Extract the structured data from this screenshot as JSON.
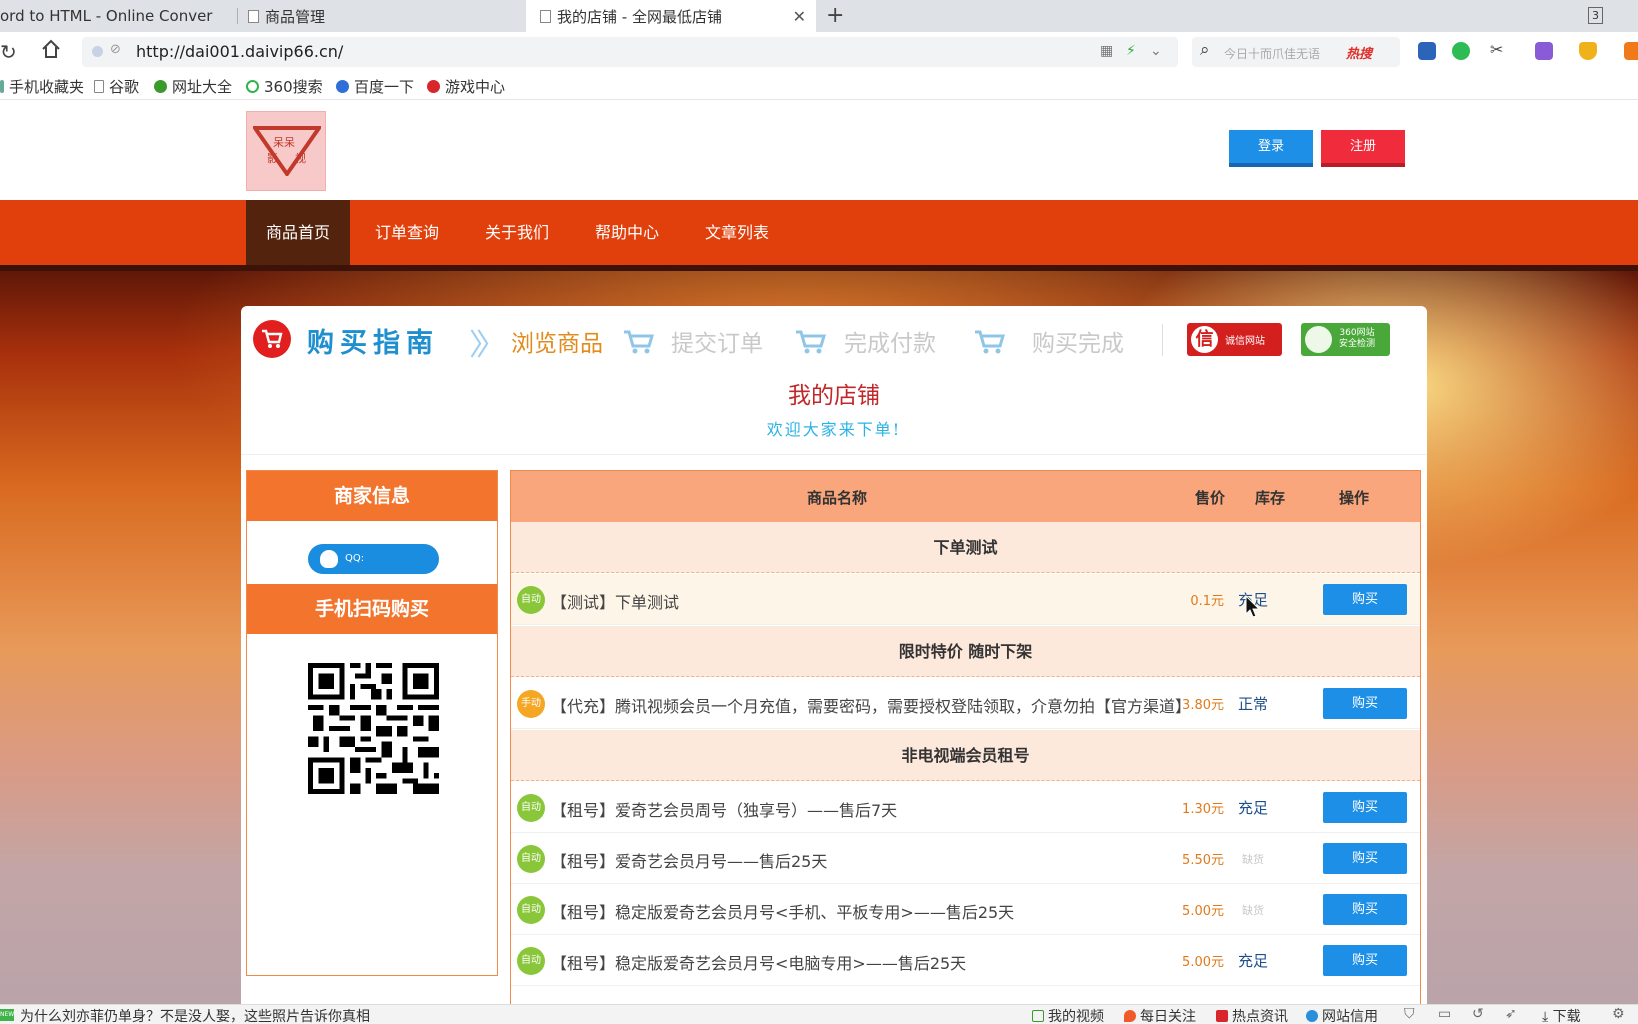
{
  "browser": {
    "tabs": [
      {
        "title": "ord to HTML - Online Conver"
      },
      {
        "title": "商品管理"
      },
      {
        "title": "我的店铺 - 全网最低店铺"
      }
    ],
    "tab_count": "3",
    "url": "http://dai001.daivip66.cn/",
    "search_placeholder": "今日十而爪佳无语",
    "search_hot": "热搜",
    "bookmarks": [
      "手机收藏夹",
      "谷歌",
      "网址大全",
      "360搜索",
      "百度一下",
      "游戏中心"
    ]
  },
  "header": {
    "logo_text": [
      "呆呆",
      "影",
      "视"
    ],
    "login_label": "登录",
    "register_label": "注册"
  },
  "nav": {
    "items": [
      "商品首页",
      "订单查询",
      "关于我们",
      "帮助中心",
      "文章列表"
    ]
  },
  "guide": {
    "title": "购买指南",
    "steps": [
      "浏览商品",
      "提交订单",
      "完成付款",
      "购买完成"
    ],
    "badge_trust": "诚信网站",
    "badge_trust_icon": "信",
    "badge_360": [
      "360网站",
      "安全检测"
    ]
  },
  "shop": {
    "title": "我的店铺",
    "subtitle": "欢迎大家来下单!"
  },
  "sidebar": {
    "merchant_title": "商家信息",
    "qq_label": "QQ:",
    "qr_title": "手机扫码购买"
  },
  "table": {
    "headers": {
      "name": "商品名称",
      "price": "售价",
      "stock": "库存",
      "action": "操作"
    },
    "categories": [
      "下单测试",
      "限时特价 随时下架",
      "非电视端会员租号"
    ],
    "rows": [
      {
        "tag": "自动",
        "name": "【测试】下单测试",
        "price": "0.1元",
        "stock": "充足",
        "buy": "购买"
      },
      {
        "tag": "手动",
        "name": "【代充】腾讯视频会员一个月充值，需要密码，需要授权登陆领取，介意勿拍【官方渠道】",
        "price": "3.80元",
        "stock": "正常",
        "buy": "购买"
      },
      {
        "tag": "自动",
        "name": "【租号】爱奇艺会员周号（独享号）——售后7天",
        "price": "1.30元",
        "stock": "充足",
        "buy": "购买"
      },
      {
        "tag": "自动",
        "name": "【租号】爱奇艺会员月号——售后25天",
        "price": "5.50元",
        "stock": "缺货",
        "buy": "购买"
      },
      {
        "tag": "自动",
        "name": "【租号】稳定版爱奇艺会员月号<手机、平板专用>——售后25天",
        "price": "5.00元",
        "stock": "缺货",
        "buy": "购买"
      },
      {
        "tag": "自动",
        "name": "【租号】稳定版爱奇艺会员月号<电脑专用>——售后25天",
        "price": "5.00元",
        "stock": "充足",
        "buy": "购买"
      }
    ]
  },
  "statusbar": {
    "news": "为什么刘亦菲仍单身？不是没人娶，这些照片告诉你真相",
    "items": [
      "我的视频",
      "每日关注",
      "热点资讯",
      "网站信用",
      "下载"
    ]
  },
  "colors": {
    "nav_bg": "#e1400d",
    "nav_active": "#54230e",
    "accent_orange": "#f3742c",
    "buy_blue": "#1e8fe6",
    "register_red": "#ef2b3c"
  }
}
